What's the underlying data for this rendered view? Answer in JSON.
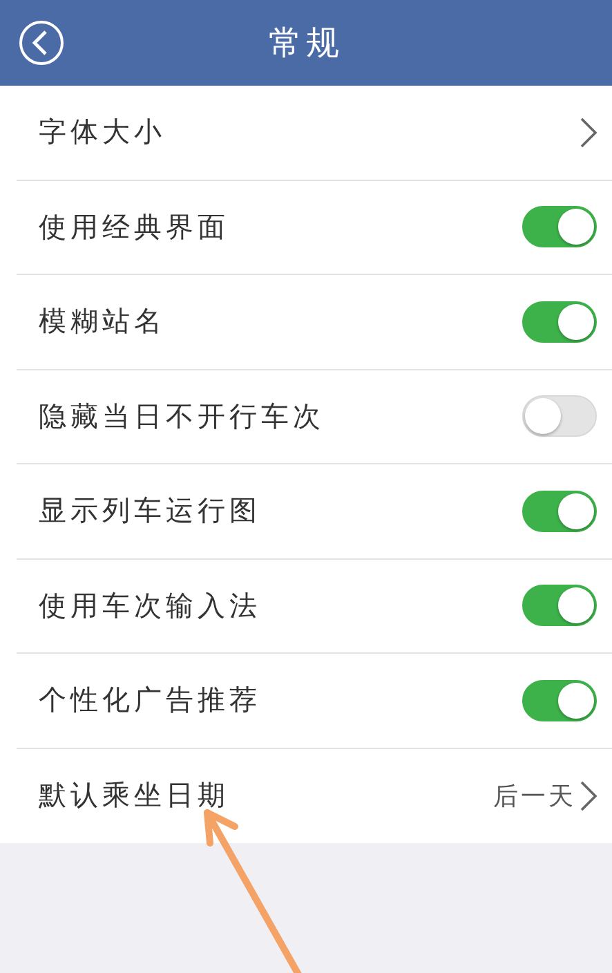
{
  "header": {
    "title": "常规"
  },
  "rows": [
    {
      "kind": "link",
      "label": "字体大小"
    },
    {
      "kind": "toggle",
      "label": "使用经典界面",
      "on": true
    },
    {
      "kind": "toggle",
      "label": "模糊站名",
      "on": true
    },
    {
      "kind": "toggle",
      "label": "隐藏当日不开行车次",
      "on": false
    },
    {
      "kind": "toggle",
      "label": "显示列车运行图",
      "on": true
    },
    {
      "kind": "toggle",
      "label": "使用车次输入法",
      "on": true
    },
    {
      "kind": "toggle",
      "label": "个性化广告推荐",
      "on": true
    },
    {
      "kind": "value",
      "label": "默认乘坐日期",
      "value": "后一天"
    }
  ]
}
